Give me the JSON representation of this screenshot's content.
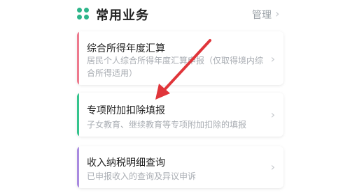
{
  "header": {
    "icon": "grid-four-dots-icon",
    "title": "常用业务",
    "manage_label": "管理"
  },
  "cards": [
    {
      "title": "综合所得年度汇算",
      "description": "居民个人综合所得年度汇算申报（仅取得境内综合所得适用）",
      "accent": "#ee7a8e"
    },
    {
      "title": "专项附加扣除填报",
      "description": "子女教育、继续教育等专项附加扣除的填报",
      "accent": "#35c48d"
    },
    {
      "title": "收入纳税明细查询",
      "description": "已申报收入的查询及异议申诉",
      "accent": "#a98ae0"
    }
  ],
  "annotation": {
    "arrow_color": "#e0353a"
  }
}
